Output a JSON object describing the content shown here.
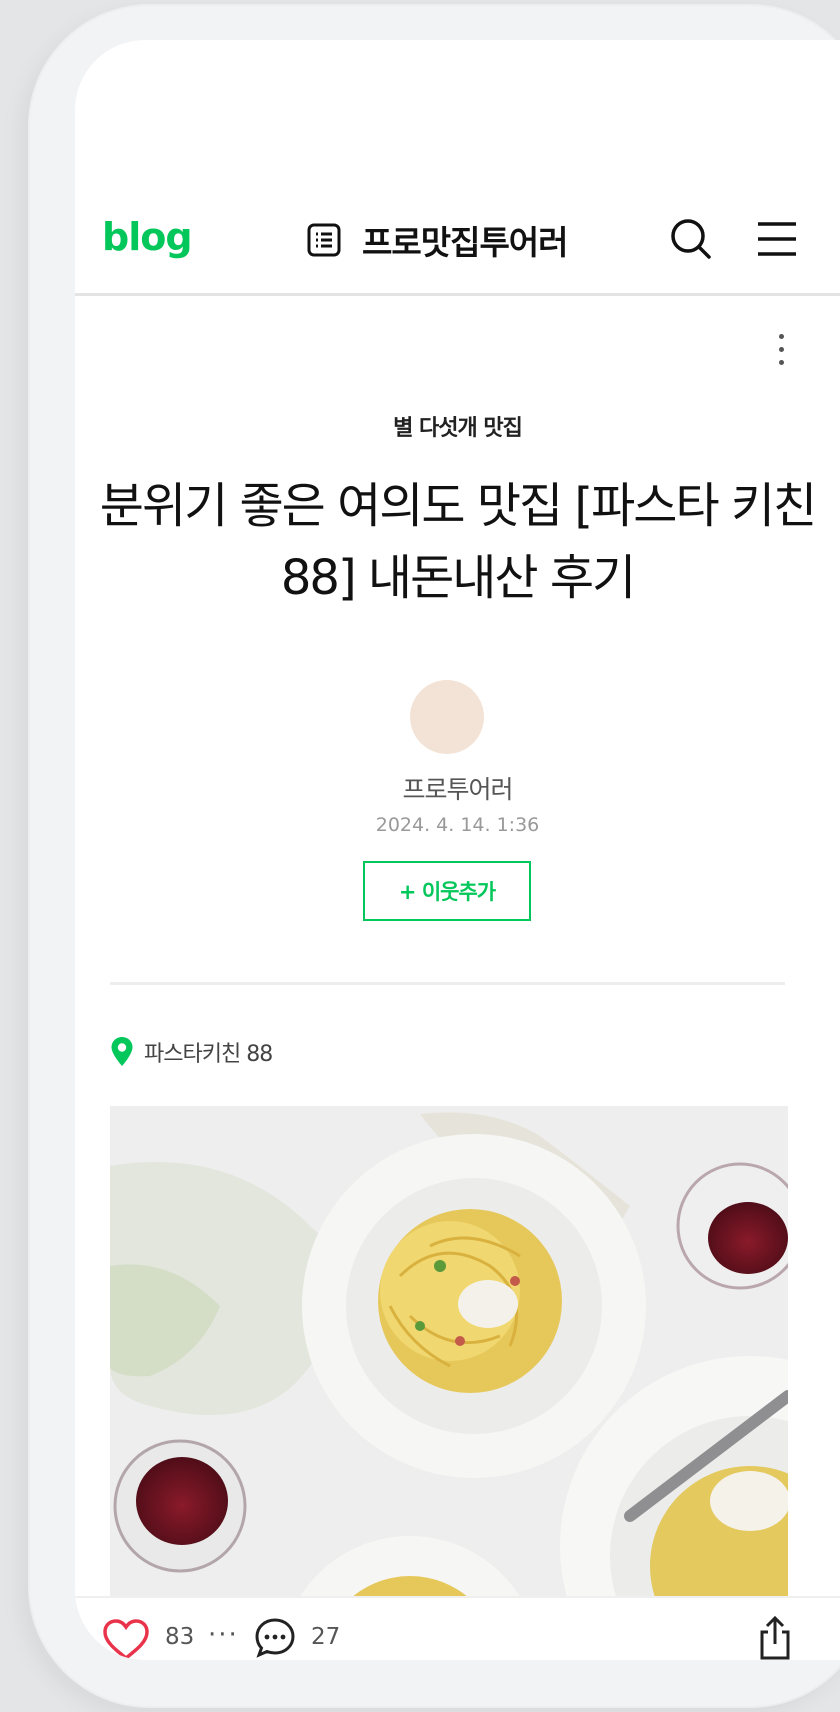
{
  "header": {
    "logo": "blog",
    "blog_name": "프로맛집투어러",
    "icons": [
      "list-icon",
      "search-icon",
      "menu-icon"
    ]
  },
  "post": {
    "category": "별 다섯개 맛집",
    "title": "분위기 좋은 여의도 맛집 [파스타 키친 88] 내돈내산 후기",
    "author": "프로투어러",
    "date": "2024. 4. 14. 1:36",
    "follow_label": "+ 이웃추가",
    "place": "파스타키친 88"
  },
  "footer": {
    "likes": "83",
    "more": "···",
    "comments": "27"
  },
  "colors": {
    "accent": "#03c75a",
    "heart": "#e8334a"
  }
}
